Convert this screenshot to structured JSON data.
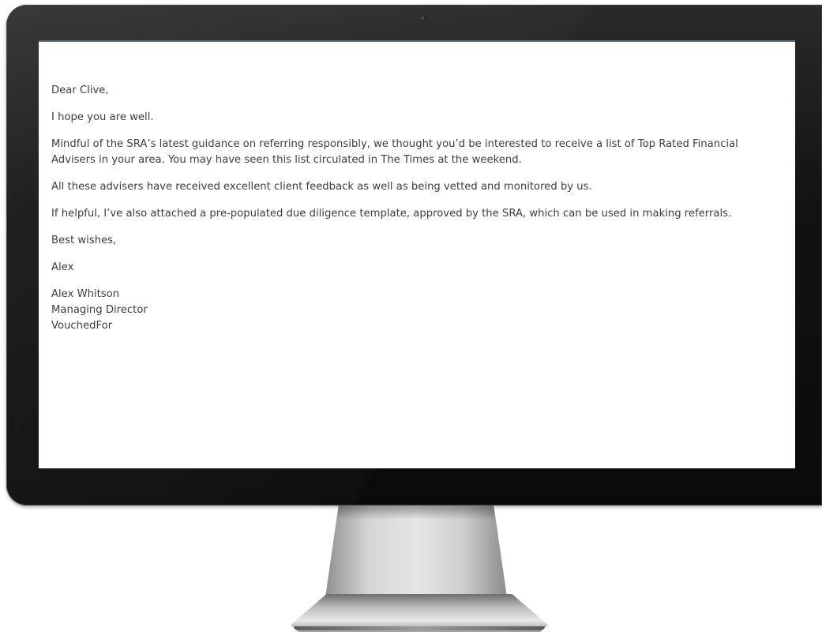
{
  "email": {
    "greeting": "Dear Clive,",
    "opening": "I hope you are well.",
    "paragraph_1": "Mindful of the SRA’s latest guidance on referring responsibly, we thought you’d be interested to receive a list of Top Rated Financial Advisers in your area. You may have seen this list circulated in The Times at the weekend.",
    "paragraph_2": "All these advisers have received excellent client feedback as well as being vetted and monitored by us.",
    "paragraph_3": "If helpful, I’ve also attached a pre-populated due diligence template, approved by the SRA, which can be used in making referrals.",
    "closing": "Best wishes,",
    "sign_off": "Alex",
    "signature": {
      "name": "Alex Whitson",
      "title": "Managing Director",
      "company": "VouchedFor"
    }
  },
  "device": {
    "type": "desktop-monitor",
    "icons": [
      "camera-icon"
    ],
    "colors": {
      "bezel": "#0f0f0f",
      "screen": "#ffffff",
      "text": "#3e3e3e",
      "screen_top_border": "#5c6e7a",
      "stand": "#d6d6d6"
    }
  }
}
